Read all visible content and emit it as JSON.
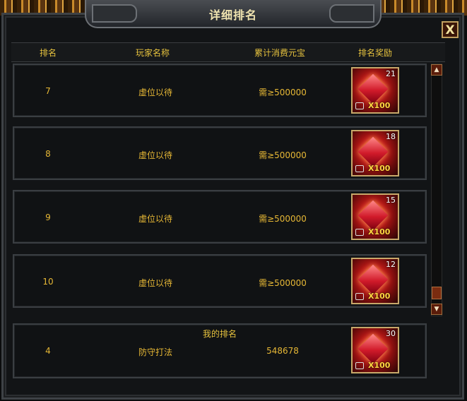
{
  "window": {
    "title": "详细排名",
    "close_label": "X"
  },
  "columns": [
    "排名",
    "玩家名称",
    "累计消费元宝",
    "排名奖励"
  ],
  "rows": [
    {
      "rank": "7",
      "name": "虚位以待",
      "value": "需≥500000",
      "reward_count": "21",
      "reward_mult": "X100"
    },
    {
      "rank": "8",
      "name": "虚位以待",
      "value": "需≥500000",
      "reward_count": "18",
      "reward_mult": "X100"
    },
    {
      "rank": "9",
      "name": "虚位以待",
      "value": "需≥500000",
      "reward_count": "15",
      "reward_mult": "X100"
    },
    {
      "rank": "10",
      "name": "虚位以待",
      "value": "需≥500000",
      "reward_count": "12",
      "reward_mult": "X100"
    }
  ],
  "my_rank": {
    "label": "我的排名",
    "rank": "4",
    "name": "防守打法",
    "value": "548678",
    "reward_count": "30",
    "reward_mult": "X100"
  },
  "colors": {
    "accent": "#e6b735",
    "frame": "#3a3e42",
    "background": "#121416"
  }
}
